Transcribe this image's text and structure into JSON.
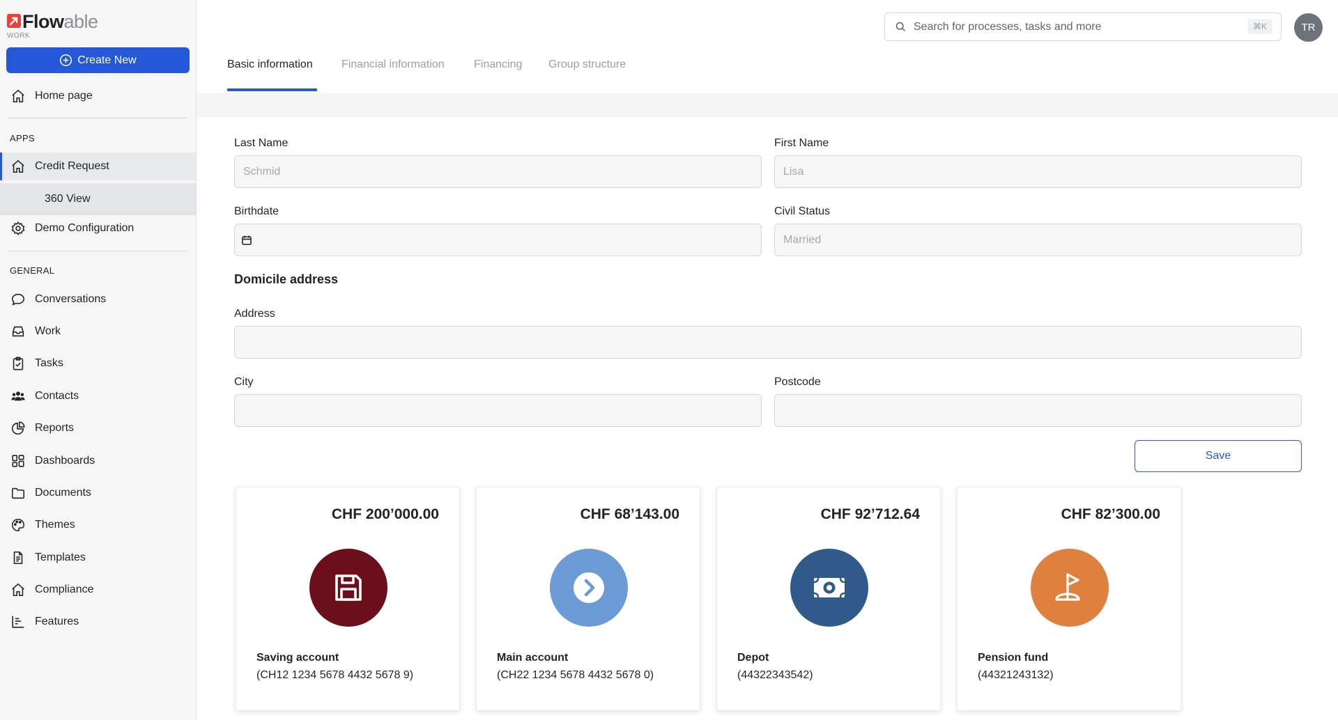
{
  "app": {
    "logo_flow": "Flow",
    "logo_able": "able",
    "logo_sub": "WORK"
  },
  "sidebar": {
    "create_new": "Create New",
    "home": "Home page",
    "apps_label": "APPS",
    "credit_request": "Credit Request",
    "view_360": "360 View",
    "demo_config": "Demo Configuration",
    "general_label": "GENERAL",
    "items": [
      {
        "label": "Conversations",
        "icon": "chat-bubble-icon"
      },
      {
        "label": "Work",
        "icon": "inbox-icon"
      },
      {
        "label": "Tasks",
        "icon": "clipboard-check-icon"
      },
      {
        "label": "Contacts",
        "icon": "users-icon"
      },
      {
        "label": "Reports",
        "icon": "pie-chart-icon"
      },
      {
        "label": "Dashboards",
        "icon": "dashboard-icon"
      },
      {
        "label": "Documents",
        "icon": "folder-icon"
      },
      {
        "label": "Themes",
        "icon": "palette-icon"
      },
      {
        "label": "Templates",
        "icon": "document-icon"
      },
      {
        "label": "Compliance",
        "icon": "home-icon"
      },
      {
        "label": "Features",
        "icon": "bar-chart-icon"
      }
    ]
  },
  "header": {
    "search_placeholder": "Search for processes, tasks and more",
    "search_shortcut": "⌘K",
    "avatar_initials": "TR"
  },
  "tabs": [
    {
      "label": "Basic information",
      "active": true
    },
    {
      "label": "Financial information",
      "active": false
    },
    {
      "label": "Financing",
      "active": false
    },
    {
      "label": "Group structure",
      "active": false
    }
  ],
  "form": {
    "last_name_label": "Last Name",
    "last_name_placeholder": "Schmid",
    "first_name_label": "First Name",
    "first_name_placeholder": "Lisa",
    "birthdate_label": "Birthdate",
    "civil_status_label": "Civil Status",
    "civil_status_placeholder": "Married",
    "domicile_heading": "Domicile address",
    "address_label": "Address",
    "address_value": "",
    "city_label": "City",
    "city_value": "",
    "postcode_label": "Postcode",
    "postcode_value": "",
    "save_label": "Save"
  },
  "accounts": [
    {
      "amount": "CHF 200’000.00",
      "name": "Saving account",
      "number": "(CH12 1234 5678 4432 5678 9)",
      "color": "#6b0f1a",
      "icon": "floppy-disk-icon"
    },
    {
      "amount": "CHF 68’143.00",
      "name": "Main account",
      "number": "(CH22 1234 5678 4432 5678 0)",
      "color": "#6d9bd6",
      "icon": "chevron-right-circle-icon"
    },
    {
      "amount": "CHF 92’712.64",
      "name": "Depot",
      "number": "(44322343542)",
      "color": "#2f5a8a",
      "icon": "banknote-icon"
    },
    {
      "amount": "CHF 82’300.00",
      "name": "Pension fund",
      "number": "(44321243132)",
      "color": "#e0803e",
      "icon": "golf-flag-icon"
    }
  ]
}
